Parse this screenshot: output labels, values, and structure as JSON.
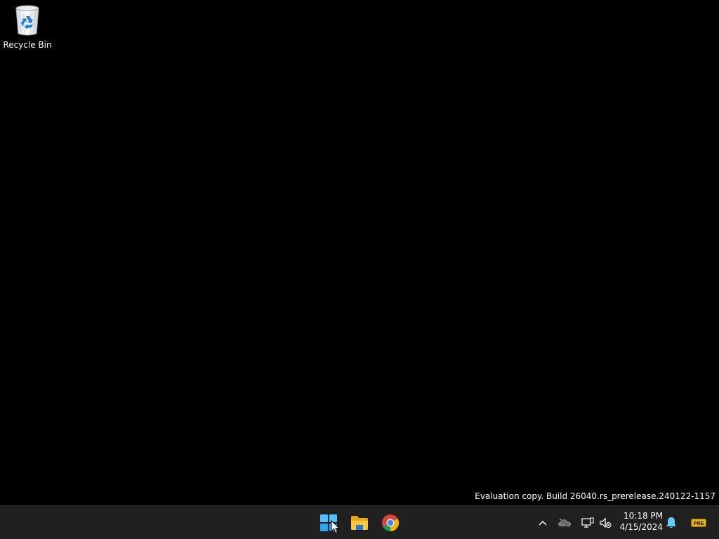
{
  "desktop": {
    "icons": [
      {
        "label": "Recycle Bin",
        "icon": "recycle-bin-icon"
      }
    ],
    "watermark": "Evaluation copy. Build 26040.rs_prerelease.240122-1157"
  },
  "taskbar": {
    "pinned": [
      {
        "name": "Start",
        "icon": "windows-start-icon"
      },
      {
        "name": "File Explorer",
        "icon": "file-explorer-icon"
      },
      {
        "name": "Google Chrome",
        "icon": "chrome-icon"
      }
    ],
    "tray": {
      "icons": [
        "chevron-up-icon",
        "onedrive-off-icon",
        "network-icon",
        "volume-muted-icon",
        "bell-icon",
        "pre-badge-icon"
      ],
      "pre_badge": "PRE",
      "time": "10:18 PM",
      "date": "4/15/2024"
    }
  },
  "colors": {
    "desktop_bg": "#000000",
    "taskbar_bg": "#202020",
    "start_blue": "#4cc2ff",
    "folder_yellow": "#f8c73a",
    "bell_blue": "#60cdff",
    "pre_badge": "#f0b400"
  }
}
